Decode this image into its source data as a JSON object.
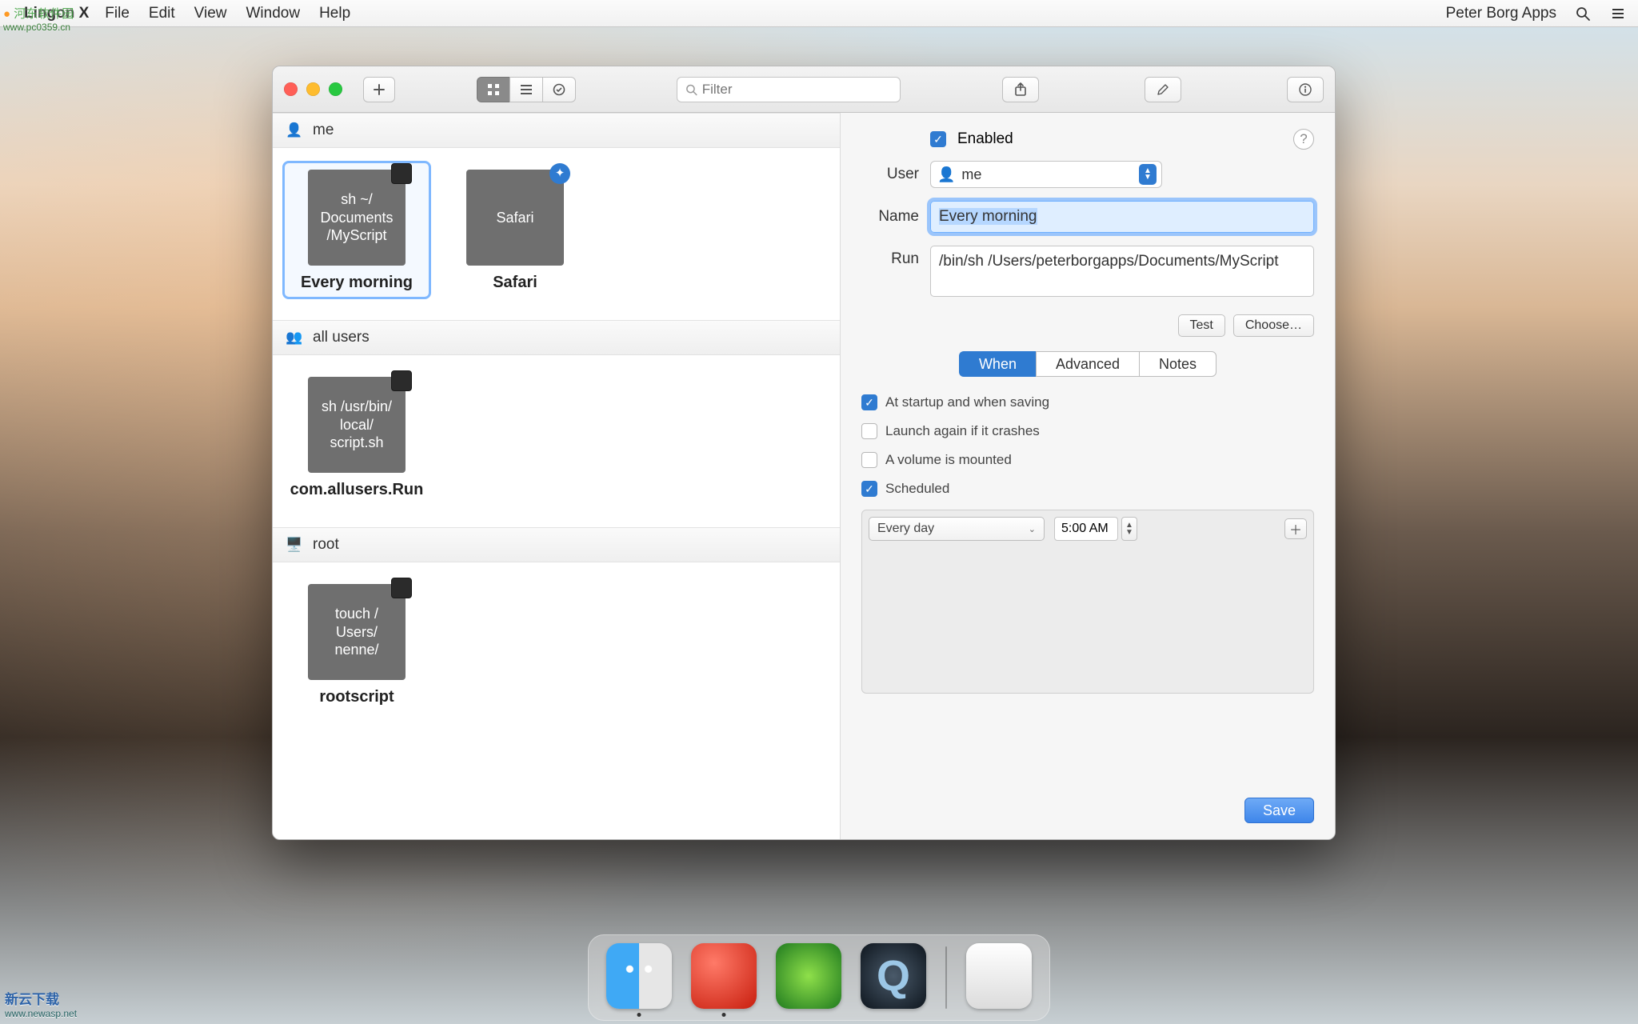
{
  "menubar": {
    "app": "Lingon X",
    "items": [
      "File",
      "Edit",
      "View",
      "Window",
      "Help"
    ],
    "right_label": "Peter Borg Apps"
  },
  "toolbar": {
    "filter_placeholder": "Filter"
  },
  "left": {
    "sections": [
      {
        "title": "me",
        "items": [
          {
            "thumb": "sh ~/\nDocuments\n/MyScript",
            "caption": "Every morning",
            "selected": true,
            "badge": "terminal"
          },
          {
            "thumb": "Safari",
            "caption": "Safari",
            "selected": false,
            "badge": "safari"
          }
        ]
      },
      {
        "title": "all users",
        "items": [
          {
            "thumb": "sh /usr/bin/\nlocal/\nscript.sh",
            "caption": "com.allusers.Run",
            "selected": false,
            "badge": "terminal"
          }
        ]
      },
      {
        "title": "root",
        "items": [
          {
            "thumb": "touch /\nUsers/\nnenne/",
            "caption": "rootscript",
            "selected": false,
            "badge": "terminal"
          }
        ]
      }
    ]
  },
  "right": {
    "enabled_label": "Enabled",
    "user_label": "User",
    "user_value": "me",
    "name_label": "Name",
    "name_value": "Every morning",
    "run_label": "Run",
    "run_value": "/bin/sh /Users/peterborgapps/Documents/MyScript",
    "test_btn": "Test",
    "choose_btn": "Choose…",
    "tabs": [
      "When",
      "Advanced",
      "Notes"
    ],
    "opts": {
      "startup": "At startup and when saving",
      "relaunch": "Launch again if it crashes",
      "volume": "A volume is mounted",
      "scheduled": "Scheduled"
    },
    "schedule_freq": "Every day",
    "schedule_time": "5:00 AM",
    "save": "Save"
  },
  "watermarks": {
    "wm1_name": "河东软件园",
    "wm1_url": "www.pc0359.cn",
    "wm2_name": "新云下载",
    "wm2_url": "www.newasp.net"
  }
}
